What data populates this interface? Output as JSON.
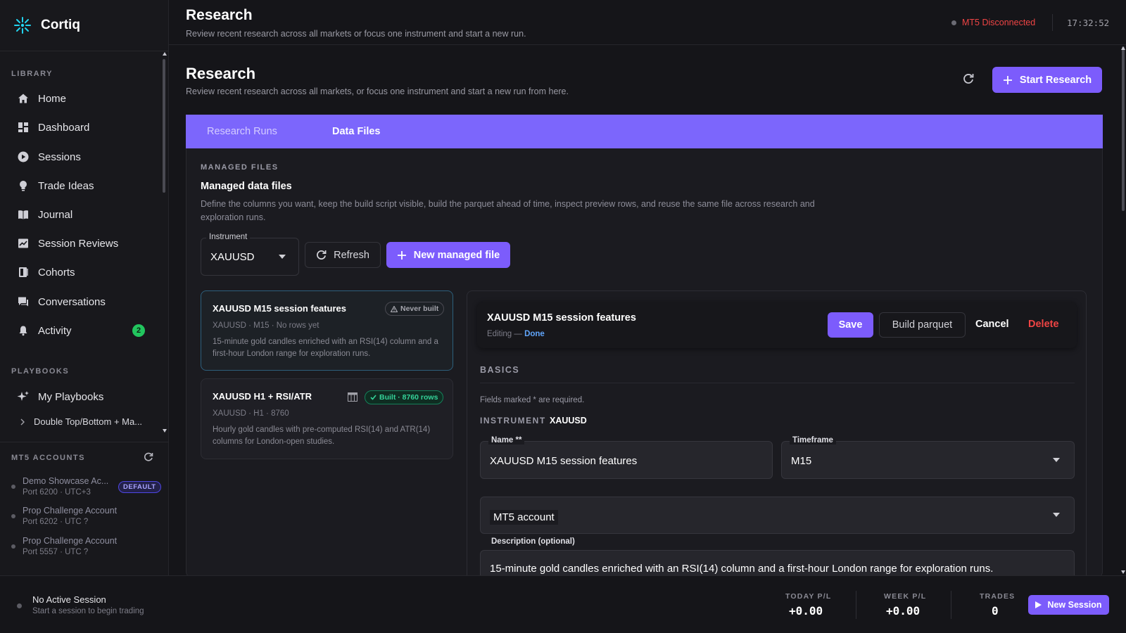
{
  "app": {
    "name": "Cortiq"
  },
  "sidebar": {
    "library_label": "LIBRARY",
    "items": [
      {
        "label": "Home",
        "icon": "home-icon"
      },
      {
        "label": "Dashboard",
        "icon": "dashboard-icon"
      },
      {
        "label": "Sessions",
        "icon": "play-circle-icon"
      },
      {
        "label": "Trade Ideas",
        "icon": "lightbulb-icon"
      },
      {
        "label": "Journal",
        "icon": "book-icon"
      },
      {
        "label": "Session Reviews",
        "icon": "review-icon"
      },
      {
        "label": "Cohorts",
        "icon": "cohorts-icon"
      },
      {
        "label": "Conversations",
        "icon": "chat-icon"
      },
      {
        "label": "Activity",
        "icon": "bell-icon",
        "badge": "2"
      }
    ],
    "playbooks_label": "PLAYBOOKS",
    "my_playbooks": "My Playbooks",
    "playbook_child": "Double Top/Bottom + Ma...",
    "mt5_accounts_label": "MT5 ACCOUNTS",
    "accounts": [
      {
        "name": "Demo Showcase Ac...",
        "meta": "Port 6200 · UTC+3",
        "badge": "DEFAULT"
      },
      {
        "name": "Prop Challenge Account",
        "meta": "Port 6202 · UTC ?"
      },
      {
        "name": "Prop Challenge Account",
        "meta": "Port 5557 · UTC ?"
      }
    ]
  },
  "header": {
    "title": "Research",
    "subtitle": "Review recent research across all markets or focus one instrument and start a new run.",
    "mt5_status": "MT5 Disconnected",
    "time": "17:32:52"
  },
  "page": {
    "title": "Research",
    "subtitle": "Review recent research across all markets, or focus one instrument and start a new run from here.",
    "start_button": "Start Research",
    "tabs": [
      {
        "label": "Research Runs"
      },
      {
        "label": "Data Files"
      }
    ]
  },
  "managed": {
    "section_label": "MANAGED FILES",
    "title": "Managed data files",
    "description": "Define the columns you want, keep the build script visible, build the parquet ahead of time, inspect preview rows, and reuse the same file across research and exploration runs.",
    "instrument_label": "Instrument",
    "instrument_value": "XAUUSD",
    "refresh_label": "Refresh",
    "new_file_label": "New managed file",
    "files": [
      {
        "title": "XAUUSD M15 session features",
        "status": "Never built",
        "meta": "XAUUSD · M15 · No rows yet",
        "description": "15-minute gold candles enriched with an RSI(14) column and a first-hour London range for exploration runs."
      },
      {
        "title": "XAUUSD H1 + RSI/ATR",
        "status": "Built · 8760 rows",
        "meta": "XAUUSD · H1 · 8760",
        "description": "Hourly gold candles with pre-computed RSI(14) and ATR(14) columns for London-open studies."
      }
    ]
  },
  "editor": {
    "title": "XAUUSD M15 session features",
    "editing_prefix": "Editing —",
    "editing_state": "Done",
    "save": "Save",
    "build": "Build parquet",
    "cancel": "Cancel",
    "delete": "Delete",
    "basics_label": "BASICS",
    "required_note": "Fields marked * are required.",
    "instrument_label": "INSTRUMENT",
    "instrument_value": "XAUUSD",
    "name_label": "Name **",
    "name_value": "XAUUSD M15 session features",
    "timeframe_label": "Timeframe",
    "timeframe_value": "M15",
    "mt5_account_placeholder": "MT5 account",
    "description_label": "Description (optional)",
    "description_value": "15-minute gold candles enriched with an RSI(14) column and a first-hour London range for exploration runs."
  },
  "footer": {
    "session_title": "No Active Session",
    "session_sub": "Start a session to begin trading",
    "today_label": "TODAY P/L",
    "today_value": "+0.00",
    "week_label": "WEEK P/L",
    "week_value": "+0.00",
    "trades_label": "TRADES",
    "trades_value": "0",
    "new_session": "New Session"
  },
  "colors": {
    "accent": "#7c5cfc",
    "tab_bar": "#7c66fc",
    "danger": "#ef4444",
    "success": "#34d399",
    "background": "#151519"
  }
}
